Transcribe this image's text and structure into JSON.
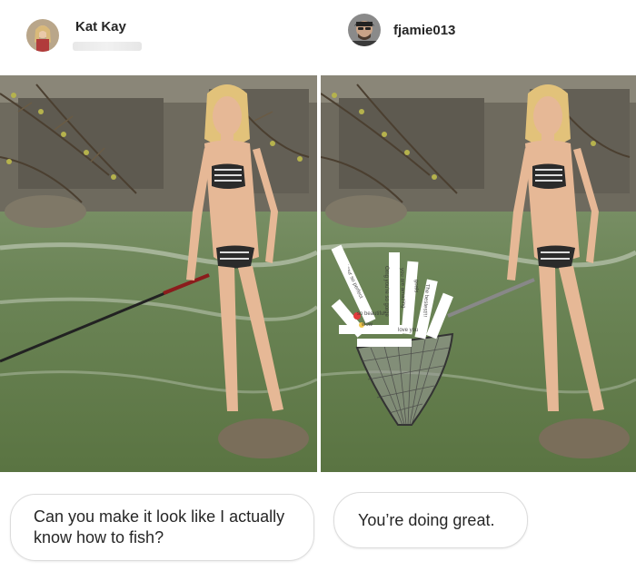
{
  "left_post": {
    "username": "Kat Kay",
    "caption": "Can you make it look like I actually know how to fish?"
  },
  "right_post": {
    "username": "fjamie013",
    "caption": "You’re doing great."
  },
  "net_notes": [
    "Omg you're so gorge",
    "The bestest!!!",
    "so beautiful",
    "you are amazing",
    "Your so perfect",
    "goals",
    "wow",
    "love you"
  ],
  "colors": {
    "bubble_border": "#dcdcdc",
    "username": "#262626",
    "water": "#6f8a5c",
    "rock": "#7a6e5a"
  }
}
